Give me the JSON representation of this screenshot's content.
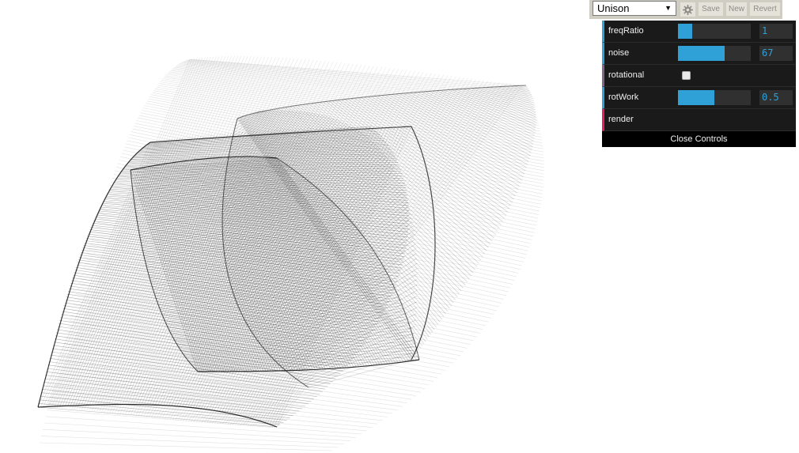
{
  "preset": {
    "selected": "Unison",
    "save_label": "Save",
    "new_label": "New",
    "revert_label": "Revert"
  },
  "controls": [
    {
      "name": "freqRatio",
      "type": "slider",
      "value": "1",
      "fill": 0.2
    },
    {
      "name": "noise",
      "type": "slider",
      "value": "67",
      "fill": 0.64
    },
    {
      "name": "rotational",
      "type": "checkbox",
      "checked": false
    },
    {
      "name": "rotWork",
      "type": "slider",
      "value": "0.5",
      "fill": 0.5
    },
    {
      "name": "render",
      "type": "function"
    }
  ],
  "close_label": "Close Controls",
  "colors": {
    "accent": "#2fa1d6",
    "panel": "#1a1a1a",
    "function": "#e61d5f",
    "boolean": "#806787"
  }
}
